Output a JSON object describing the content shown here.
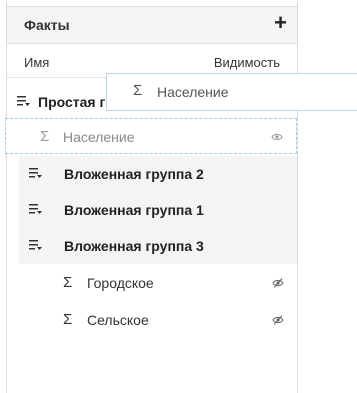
{
  "panel": {
    "title": "Факты",
    "add_glyph": "+",
    "columns": {
      "name": "Имя",
      "visibility": "Видимость"
    }
  },
  "rows": {
    "group_simple": {
      "label": "Простая г",
      "icon": "group-icon"
    },
    "measure_population": {
      "label": "Население",
      "icon": "sigma-icon",
      "visibility": "visible"
    },
    "nested_2": {
      "label": "Вложенная группа 2",
      "icon": "group-icon"
    },
    "nested_1": {
      "label": "Вложенная группа 1",
      "icon": "group-icon"
    },
    "nested_3": {
      "label": "Вложенная группа 3",
      "icon": "group-icon"
    },
    "urban": {
      "label": "Городское",
      "icon": "sigma-icon",
      "visibility": "hidden"
    },
    "rural": {
      "label": "Сельское",
      "icon": "sigma-icon",
      "visibility": "hidden"
    }
  },
  "drag_ghost": {
    "label": "Население",
    "icon": "sigma-icon"
  },
  "glyphs": {
    "sigma": "Σ"
  },
  "colors": {
    "drop_border": "#a9c9e6",
    "ghost_border": "#b9d5ef",
    "shaded_bg": "#f4f4f4"
  }
}
